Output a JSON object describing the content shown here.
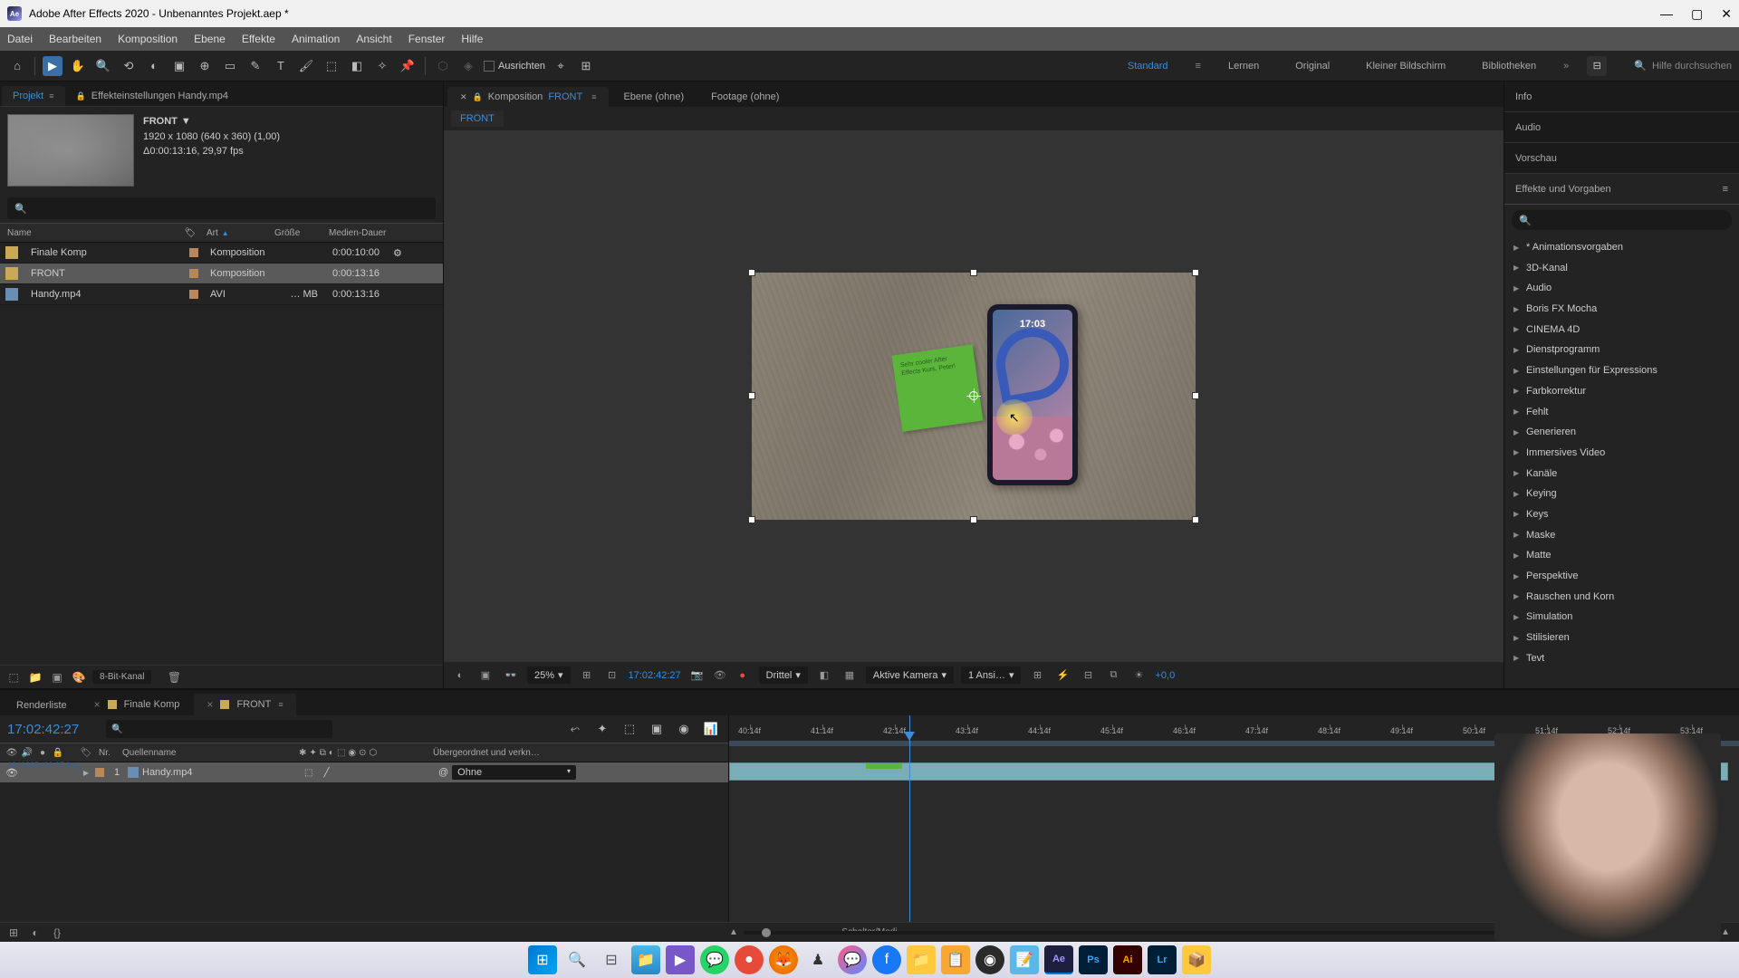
{
  "titlebar": {
    "title": "Adobe After Effects 2020 - Unbenanntes Projekt.aep *"
  },
  "menubar": [
    "Datei",
    "Bearbeiten",
    "Komposition",
    "Ebene",
    "Effekte",
    "Animation",
    "Ansicht",
    "Fenster",
    "Hilfe"
  ],
  "toolbar": {
    "ausrichten": "Ausrichten",
    "workspaces": [
      "Standard",
      "Lernen",
      "Original",
      "Kleiner Bildschirm",
      "Bibliotheken"
    ],
    "search_placeholder": "Hilfe durchsuchen"
  },
  "project": {
    "tab_project": "Projekt",
    "tab_effects": "Effekteinstellungen Handy.mp4",
    "selected_name": "FRONT",
    "selected_meta1": "1920 x 1080 (640 x 360) (1,00)",
    "selected_meta2": "Δ0:00:13:16, 29,97 fps",
    "columns": {
      "name": "Name",
      "art": "Art",
      "groesse": "Größe",
      "dauer": "Medien-Dauer"
    },
    "rows": [
      {
        "icon": "comp",
        "name": "Finale Komp",
        "art": "Komposition",
        "groesse": "",
        "dauer": "0:00:10:00",
        "selected": false,
        "extra": "⚙"
      },
      {
        "icon": "comp",
        "name": "FRONT",
        "art": "Komposition",
        "groesse": "",
        "dauer": "0:00:13:16",
        "selected": true,
        "extra": ""
      },
      {
        "icon": "avi",
        "name": "Handy.mp4",
        "art": "AVI",
        "groesse": "… MB",
        "dauer": "0:00:13:16",
        "selected": false,
        "extra": ""
      }
    ],
    "footer_depth": "8-Bit-Kanal"
  },
  "comp": {
    "tabs": [
      {
        "prefix": "Komposition",
        "name": "FRONT",
        "active": true,
        "lock": true
      },
      {
        "prefix": "",
        "name": "Ebene (ohne)",
        "active": false
      },
      {
        "prefix": "",
        "name": "Footage (ohne)",
        "active": false
      }
    ],
    "breadcrumb": "FRONT",
    "phone_time": "17:03",
    "postit_text": "Sehr cooler\nAfter Effects\nKurs, Peter!",
    "footer": {
      "zoom": "25%",
      "time": "17:02:42:27",
      "resolution": "Drittel",
      "camera": "Aktive Kamera",
      "views": "1 Ansi…",
      "exposure": "+0,0"
    }
  },
  "right": {
    "panels": [
      "Info",
      "Audio",
      "Vorschau",
      "Effekte und Vorgaben"
    ],
    "effects": [
      "* Animationsvorgaben",
      "3D-Kanal",
      "Audio",
      "Boris FX Mocha",
      "CINEMA 4D",
      "Dienstprogramm",
      "Einstellungen für Expressions",
      "Farbkorrektur",
      "Fehlt",
      "Generieren",
      "Immersives Video",
      "Kanäle",
      "Keying",
      "Keys",
      "Maske",
      "Matte",
      "Perspektive",
      "Rauschen und Korn",
      "Simulation",
      "Stilisieren",
      "Tevt"
    ]
  },
  "timeline": {
    "tabs": [
      {
        "name": "Renderliste",
        "closable": false,
        "active": false
      },
      {
        "name": "Finale Komp",
        "closable": true,
        "active": false
      },
      {
        "name": "FRONT",
        "closable": true,
        "active": true
      }
    ],
    "timecode": "17:02:42:27",
    "frames_label": "1840887 (29,97 fps)",
    "columns": {
      "nr": "Nr.",
      "quelle": "Quellenname",
      "parent": "Übergeordnet und verkn…"
    },
    "ticks": [
      "40:14f",
      "41:14f",
      "42:14f",
      "43:14f",
      "44:14f",
      "45:14f",
      "46:14f",
      "47:14f",
      "48:14f",
      "49:14f",
      "50:14f",
      "51:14f",
      "52:14f",
      "53:14f"
    ],
    "layers": [
      {
        "nr": "1",
        "name": "Handy.mp4",
        "parent": "Ohne",
        "selected": true
      }
    ],
    "footer_label": "Schalter/Modi"
  }
}
